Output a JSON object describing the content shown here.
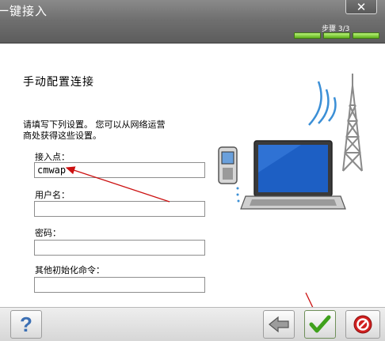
{
  "window": {
    "title": "一键接入",
    "close_icon": "close-icon"
  },
  "steps": {
    "label": "步骤 3/3",
    "current": 3,
    "total": 3
  },
  "page": {
    "heading": "手动配置连接",
    "description_line1": "请填写下列设置。 您可以从网络运营",
    "description_line2": "商处获得这些设置。"
  },
  "fields": {
    "apn": {
      "label": "接入点：",
      "value": "cmwap"
    },
    "username": {
      "label": "用户名：",
      "value": ""
    },
    "password": {
      "label": "密码：",
      "value": ""
    },
    "init_command": {
      "label": "其他初始化命令：",
      "value": ""
    }
  },
  "buttons": {
    "help": "?",
    "back_icon": "back-arrow-icon",
    "finish_icon": "checkmark-icon",
    "cancel_icon": "cancel-icon"
  },
  "colors": {
    "titlebar": "#6d6d6d",
    "progress": "#5fb21c",
    "annotation_arrow": "#cc1111",
    "check": "#3fa11c",
    "cancel": "#d11f1f"
  }
}
